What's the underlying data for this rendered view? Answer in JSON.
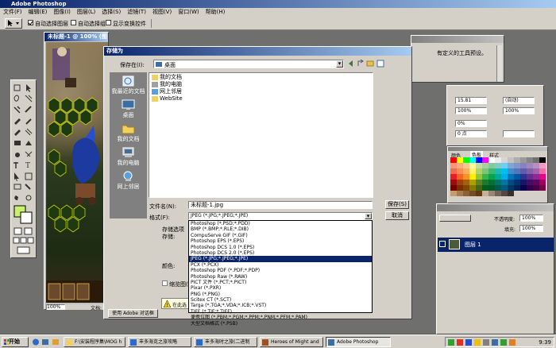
{
  "app": {
    "title": "Adobe Photoshop",
    "menu": [
      "文件(F)",
      "编辑(E)",
      "图像(I)",
      "图层(L)",
      "选择(S)",
      "滤镜(T)",
      "视图(V)",
      "窗口(W)",
      "帮助(H)"
    ],
    "options": {
      "auto_select_layer": "自动选择图层",
      "auto_select_group": "自动选择组",
      "show_bounding": "显示变换控件"
    }
  },
  "document": {
    "title": "未标题-1 @ 100% (图层 1, RGB/8)",
    "zoom": "100%",
    "status": "文档:"
  },
  "save_dialog": {
    "title": "存储为",
    "save_in_label": "保存在(I):",
    "save_in_value": "桌面",
    "places": [
      "我最近的文档",
      "桌面",
      "我的文档",
      "我的电脑",
      "网上邻居"
    ],
    "files": [
      "我的文档",
      "我的电脑",
      "网上邻居",
      "WebSite"
    ],
    "filename_label": "文件名(N):",
    "filename_value": "未标题-1.jpg",
    "format_label": "格式(F):",
    "format_value": "JPEG (*.JPG;*.JPEG;*.JPE)",
    "save_button": "保存(S)",
    "cancel_button": "取消",
    "save_options_label": "存储选项",
    "store_label": "存储:",
    "color_label": "颜色:",
    "thumbnail_label": "缩览图(T)",
    "use_adobe_dialog": "使用 Adobe 对话框",
    "warning_text": "在此选",
    "formats": [
      "Photoshop (*.PSD;*.PDD)",
      "BMP (*.BMP;*.RLE;*.DIB)",
      "CompuServe GIF (*.GIF)",
      "Photoshop EPS (*.EPS)",
      "Photoshop DCS 1.0 (*.EPS)",
      "Photoshop DCS 2.0 (*.EPS)",
      "JPEG (*.JPG;*.JPEG;*.JPE)",
      "PCX (*.PCX)",
      "Photoshop PDF (*.PDF;*.PDP)",
      "Photoshop Raw (*.RAW)",
      "PICT 文件 (*.PCT;*.PICT)",
      "Pixar (*.PXR)",
      "PNG (*.PNG)",
      "Scitex CT (*.SCT)",
      "Targa (*.TGA;*.VDA;*.ICB;*.VST)",
      "TIFF (*.TIF;*.TIFF)",
      "便携位图 (*.PBM;*.PGM;*.PPM;*.PNM;*.PFM;*.PAM)",
      "大型文档格式 (*.PSB)"
    ],
    "selected_format_index": 6
  },
  "nav_panel": {
    "text": "有定义的工具预设。"
  },
  "char_panel": {
    "leading": "15.81",
    "auto": "(自动)",
    "scale_v": "100%",
    "scale_h": "100%",
    "tracking": "0%",
    "baseline": "0 点"
  },
  "swatch_panel": {
    "tab_color": "颜色",
    "tab_swatches": "色板",
    "tab_styles": "样式"
  },
  "layers_panel": {
    "opacity_label": "不透明度:",
    "opacity_value": "100%",
    "fill_label": "填充:",
    "fill_value": "100%",
    "layer_name": "图层 1"
  },
  "taskbar": {
    "start": "开始",
    "tasks": [
      "F:\\安装程序集\\MOG h",
      "丰多海克之旅攻略",
      "丰多海时之旅(二进制",
      "Heroes of Might and",
      "Adobe Photoshop"
    ],
    "clock": "9:39"
  }
}
